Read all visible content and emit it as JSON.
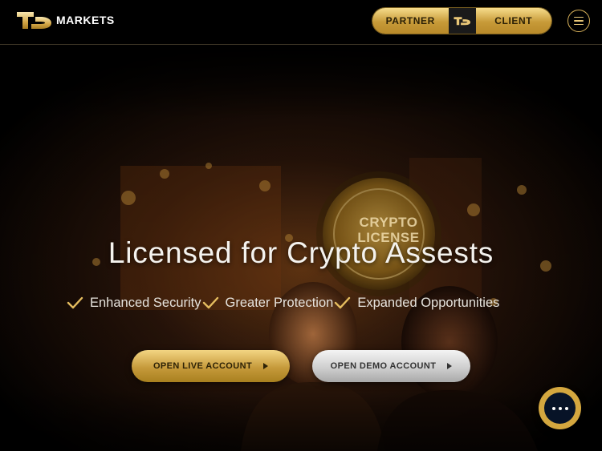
{
  "header": {
    "brand": "MARKETS",
    "switch": {
      "left_label": "PARTNER",
      "right_label": "CLIENT",
      "mid_icon": "td-logo-icon"
    },
    "menu_icon": "hamburger-menu-icon"
  },
  "hero": {
    "title": "Licensed for Crypto Assests",
    "badge_text": [
      "CRYPTO",
      "LICENSE"
    ],
    "features": [
      {
        "icon": "check-icon",
        "label": "Enhanced Security"
      },
      {
        "icon": "check-icon",
        "label": "Greater Protection"
      },
      {
        "icon": "check-icon",
        "label": "Expanded Opportunities"
      }
    ],
    "cta_live": "OPEN LIVE ACCOUNT",
    "cta_demo": "OPEN DEMO ACCOUNT"
  },
  "chat": {
    "icon": "chat-bubble-icon"
  },
  "colors": {
    "gold": "#d4a73f",
    "background": "#000000",
    "chat_inner": "#071327"
  }
}
